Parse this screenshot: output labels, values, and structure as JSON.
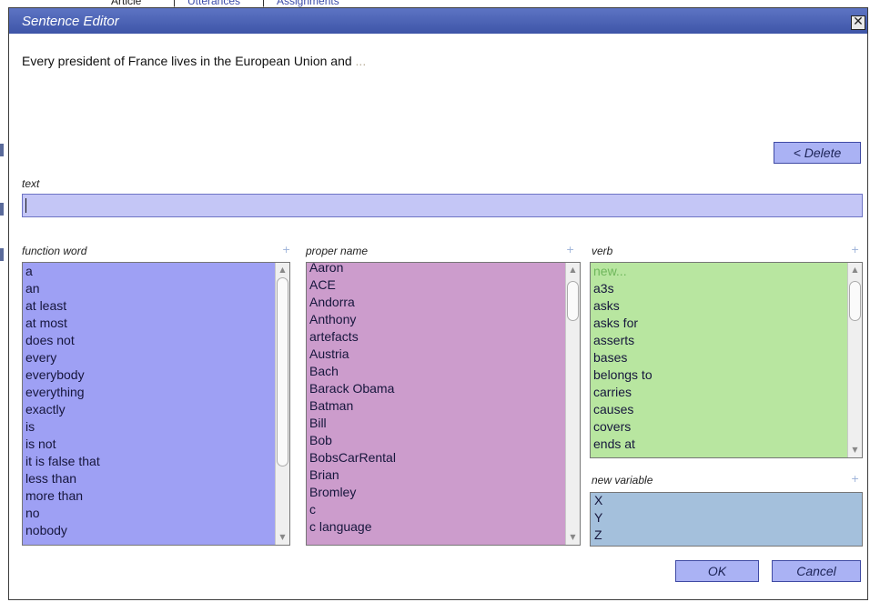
{
  "background_page": {
    "fragments": [
      "Article",
      "Utterances",
      "Assignments"
    ]
  },
  "dialog": {
    "title": "Sentence Editor",
    "close_glyph": "✕",
    "sentence": "Every president of France lives in the European Union and",
    "ellipsis": "...",
    "delete_label": "< Delete",
    "text_label": "text",
    "text_value": "",
    "ok_label": "OK",
    "cancel_label": "Cancel"
  },
  "lists": {
    "function_word": {
      "label": "function word",
      "items": [
        "a",
        "an",
        "at least",
        "at most",
        "does not",
        "every",
        "everybody",
        "everything",
        "exactly",
        "is",
        "is not",
        "it is false that",
        "less than",
        "more than",
        "no",
        "nobody"
      ]
    },
    "proper_name": {
      "label": "proper name",
      "items": [
        "Aaron",
        "ACE",
        "Andorra",
        "Anthony",
        "artefacts",
        "Austria",
        "Bach",
        "Barack Obama",
        "Batman",
        "Bill",
        "Bob",
        "BobsCarRental",
        "Brian",
        "Bromley",
        "c",
        "c language"
      ]
    },
    "verb": {
      "label": "verb",
      "new_item": "new...",
      "items": [
        "a3s",
        "asks",
        "asks for",
        "asserts",
        "bases",
        "belongs to",
        "carries",
        "causes",
        "covers",
        "ends at"
      ]
    },
    "new_variable": {
      "label": "new variable",
      "items": [
        "X",
        "Y",
        "Z"
      ]
    }
  },
  "add_glyph": "+",
  "scroll_up_glyph": "▲",
  "scroll_down_glyph": "▼",
  "colors": {
    "titlebar": "#4a60b4",
    "function_word_bg": "#9ea0f4",
    "proper_name_bg": "#cc9ccc",
    "verb_bg": "#b8e6a0",
    "new_variable_bg": "#a4c0dc",
    "button_bg": "#aab2f4",
    "text_field_bg": "#c4c6f6"
  },
  "icons": [
    "close-icon",
    "add-icon",
    "scroll-up-icon",
    "scroll-down-icon"
  ]
}
